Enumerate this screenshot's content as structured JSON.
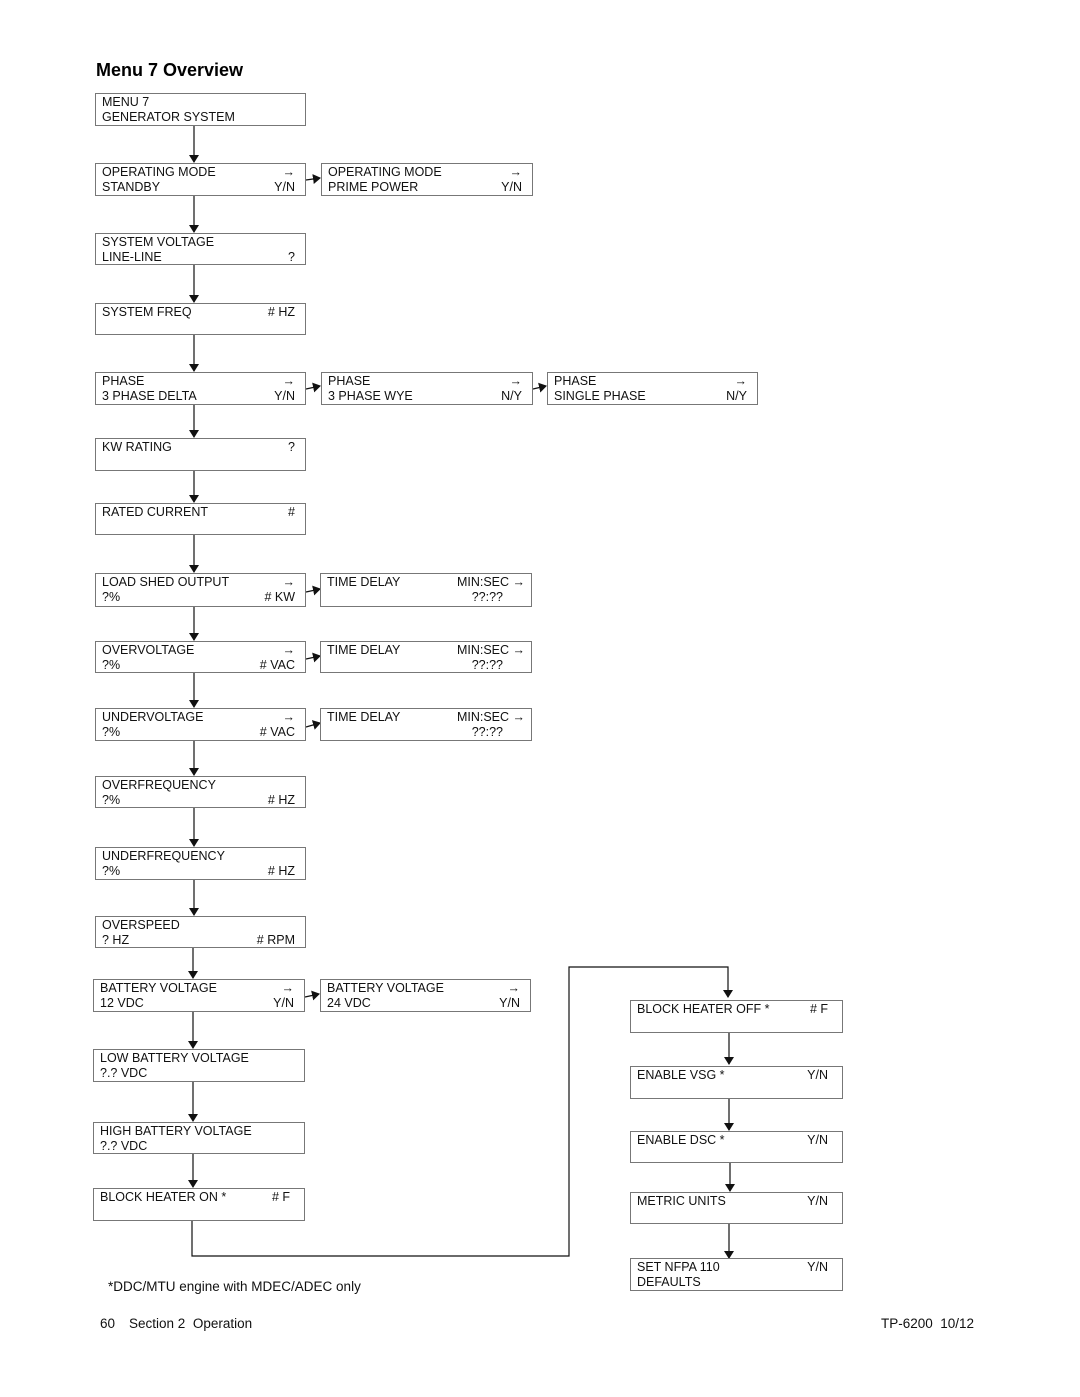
{
  "page_title": "Menu 7 Overview",
  "boxes": {
    "menu7": {
      "line1_left": "MENU 7",
      "line1_right": "",
      "line2_left": "GENERATOR SYSTEM",
      "line2_right": ""
    },
    "op_standby": {
      "line1_left": "OPERATING MODE",
      "line1_right": "→",
      "line2_left": "STANDBY",
      "line2_right": "Y/N"
    },
    "op_prime": {
      "line1_left": "OPERATING MODE",
      "line1_right": "→",
      "line2_left": "PRIME POWER",
      "line2_right": "Y/N"
    },
    "sys_voltage": {
      "line1_left": "SYSTEM VOLTAGE",
      "line1_right": "",
      "line2_left": "LINE-LINE",
      "line2_right": "?"
    },
    "sys_freq": {
      "line1_left": "SYSTEM FREQ",
      "line1_right": "# HZ",
      "line2_left": "",
      "line2_right": ""
    },
    "phase_delta": {
      "line1_left": "PHASE",
      "line1_right": "→",
      "line2_left": "3 PHASE DELTA",
      "line2_right": "Y/N"
    },
    "phase_wye": {
      "line1_left": "PHASE",
      "line1_right": "→",
      "line2_left": "3 PHASE WYE",
      "line2_right": "N/Y"
    },
    "phase_single": {
      "line1_left": "PHASE",
      "line1_right": "→",
      "line2_left": "SINGLE PHASE",
      "line2_right": "N/Y"
    },
    "kw_rating": {
      "line1_left": "KW RATING",
      "line1_right": "?",
      "line2_left": "",
      "line2_right": ""
    },
    "rated_current": {
      "line1_left": "RATED CURRENT",
      "line1_right": "#",
      "line2_left": "",
      "line2_right": ""
    },
    "load_shed": {
      "line1_left": "LOAD SHED OUTPUT",
      "line1_right": "→",
      "line2_left": "?%",
      "line2_right": "# KW"
    },
    "load_shed_td": {
      "line1_left": "TIME DELAY",
      "line1_right": "MIN:SEC →",
      "line2_left": "",
      "line2_right": "??:??"
    },
    "overvoltage": {
      "line1_left": "OVERVOLTAGE",
      "line1_right": "→",
      "line2_left": "?%",
      "line2_right": "# VAC"
    },
    "overvoltage_td": {
      "line1_left": "TIME DELAY",
      "line1_right": "MIN:SEC →",
      "line2_left": "",
      "line2_right": "??:??"
    },
    "undervoltage": {
      "line1_left": "UNDERVOLTAGE",
      "line1_right": "→",
      "line2_left": "?%",
      "line2_right": "# VAC"
    },
    "undervoltage_td": {
      "line1_left": "TIME DELAY",
      "line1_right": "MIN:SEC →",
      "line2_left": "",
      "line2_right": "??:??"
    },
    "overfrequency": {
      "line1_left": "OVERFREQUENCY",
      "line1_right": "",
      "line2_left": "?%",
      "line2_right": "# HZ"
    },
    "underfrequency": {
      "line1_left": "UNDERFREQUENCY",
      "line1_right": "",
      "line2_left": "?%",
      "line2_right": "# HZ"
    },
    "overspeed": {
      "line1_left": "OVERSPEED",
      "line1_right": "",
      "line2_left": "? HZ",
      "line2_right": "# RPM"
    },
    "battery_12": {
      "line1_left": "BATTERY VOLTAGE",
      "line1_right": "→",
      "line2_left": "12 VDC",
      "line2_right": "Y/N"
    },
    "battery_24": {
      "line1_left": "BATTERY VOLTAGE",
      "line1_right": "→",
      "line2_left": "24 VDC",
      "line2_right": "Y/N"
    },
    "low_battery": {
      "line1_left": "LOW BATTERY VOLTAGE",
      "line1_right": "",
      "line2_left": "?.? VDC",
      "line2_right": ""
    },
    "high_battery": {
      "line1_left": "HIGH BATTERY VOLTAGE",
      "line1_right": "",
      "line2_left": "?.? VDC",
      "line2_right": ""
    },
    "block_heater_on": {
      "line1_left": "BLOCK HEATER ON *",
      "line1_right": "# F",
      "line2_left": "",
      "line2_right": ""
    },
    "block_heater_off": {
      "line1_left": "BLOCK HEATER OFF *",
      "line1_right": "# F",
      "line2_left": "",
      "line2_right": ""
    },
    "enable_vsg": {
      "line1_left": "ENABLE VSG *",
      "line1_right": "Y/N",
      "line2_left": "",
      "line2_right": ""
    },
    "enable_dsc": {
      "line1_left": "ENABLE DSC *",
      "line1_right": "Y/N",
      "line2_left": "",
      "line2_right": ""
    },
    "metric_units": {
      "line1_left": "METRIC UNITS",
      "line1_right": "Y/N",
      "line2_left": "",
      "line2_right": ""
    },
    "nfpa_defaults": {
      "line1_left": "SET NFPA 110",
      "line1_right": "Y/N",
      "line2_left": "DEFAULTS",
      "line2_right": ""
    }
  },
  "footnote": "*DDC/MTU engine with MDEC/ADEC only",
  "footer": {
    "page_number": "60",
    "section": "Section 2  Operation",
    "doc_id": "TP-6200  10/12"
  }
}
